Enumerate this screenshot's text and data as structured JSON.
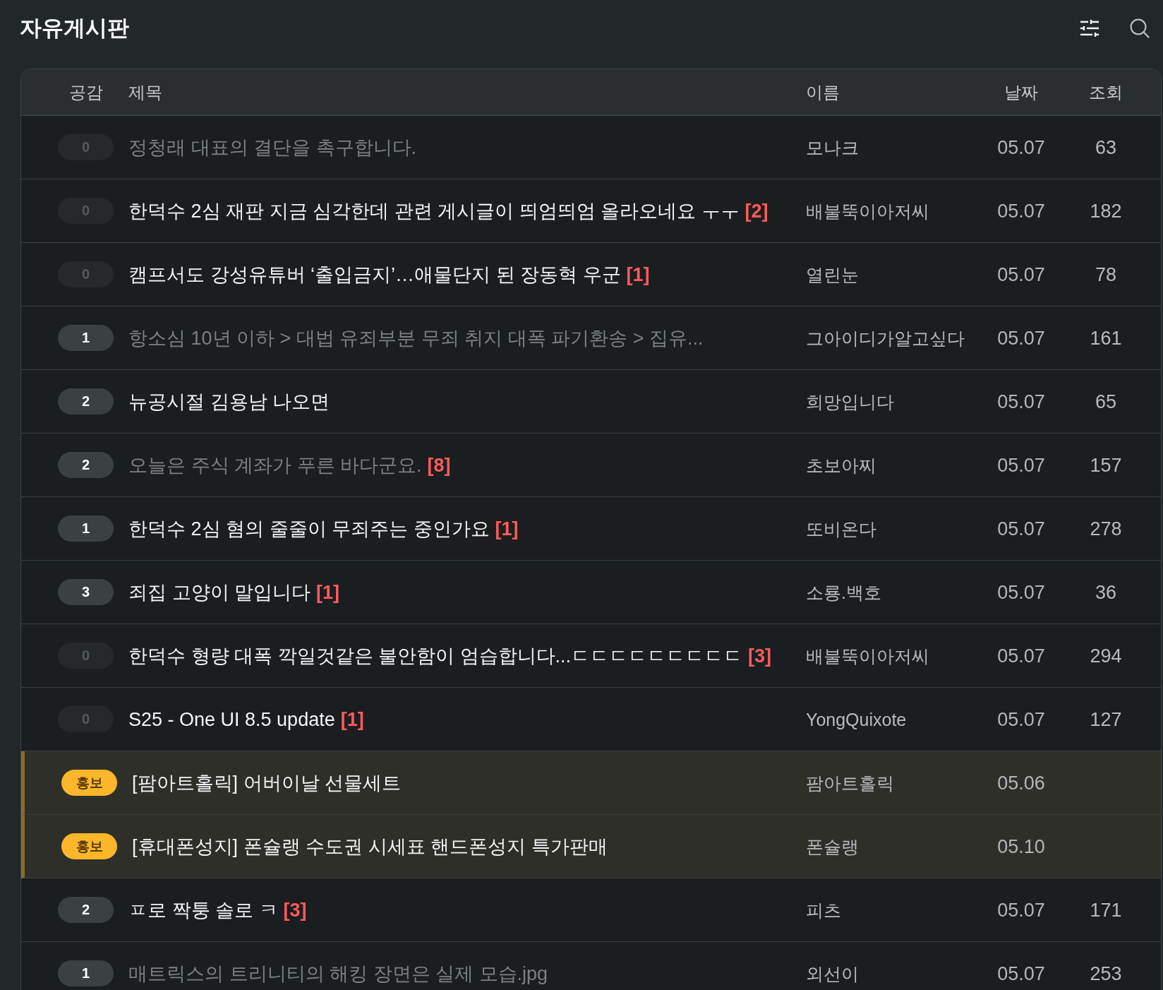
{
  "header": {
    "title": "자유게시판"
  },
  "table": {
    "columns": [
      "공감",
      "제목",
      "이름",
      "날짜",
      "조회"
    ],
    "rows": [
      {
        "kind": "post",
        "likes": "0",
        "likes_dimmed": true,
        "title": {
          "text": "정청래 대표의 결단을 촉구합니다."
        },
        "read": true,
        "author": "모나크",
        "date": "05.07",
        "views": "63"
      },
      {
        "kind": "post",
        "likes": "0",
        "likes_dimmed": true,
        "title": {
          "text": "한덕수 2심 재판 지금 심각한데 관련 게시글이 띄엄띄엄 올라오네요 ㅜㅜ",
          "comments": "[2]"
        },
        "read": false,
        "author": "배불뚝이아저씨",
        "date": "05.07",
        "views": "182"
      },
      {
        "kind": "post",
        "likes": "0",
        "likes_dimmed": true,
        "title": {
          "text": "캠프서도 강성유튜버 ‘출입금지’…애물단지 된 장동혁 우군",
          "comments": "[1]"
        },
        "read": false,
        "author": "열린눈",
        "date": "05.07",
        "views": "78"
      },
      {
        "kind": "post",
        "likes": "1",
        "likes_dimmed": false,
        "title": {
          "text": "항소심 10년 이하 > 대법 유죄부분 무죄 취지 대폭 파기환송 > 집유..."
        },
        "read": true,
        "author": "그아이디가알고싶다",
        "date": "05.07",
        "views": "161"
      },
      {
        "kind": "post",
        "likes": "2",
        "likes_dimmed": false,
        "title": {
          "text": "뉴공시절 김용남 나오면"
        },
        "read": false,
        "author": "희망입니다",
        "date": "05.07",
        "views": "65"
      },
      {
        "kind": "post",
        "likes": "2",
        "likes_dimmed": false,
        "title": {
          "text": "오늘은 주식 계좌가 푸른 바다군요.",
          "comments": "[8]"
        },
        "read": true,
        "author": "초보아찌",
        "date": "05.07",
        "views": "157"
      },
      {
        "kind": "post",
        "likes": "1",
        "likes_dimmed": false,
        "title": {
          "text": "한덕수 2심 혐의 줄줄이 무죄주는 중인가요",
          "comments": "[1]"
        },
        "read": false,
        "author": "또비온다",
        "date": "05.07",
        "views": "278"
      },
      {
        "kind": "post",
        "likes": "3",
        "likes_dimmed": false,
        "title": {
          "text": "죄집 고양이 말입니다",
          "comments": "[1]"
        },
        "read": false,
        "author": "소룡.백호",
        "date": "05.07",
        "views": "36"
      },
      {
        "kind": "post",
        "likes": "0",
        "likes_dimmed": true,
        "title": {
          "text": "한덕수 형량 대폭 깍일것같은 불안함이 엄습합니다...ㄷㄷㄷㄷㄷㄷㄷㄷㄷ",
          "comments": "[3]"
        },
        "read": false,
        "author": "배불뚝이아저씨",
        "date": "05.07",
        "views": "294"
      },
      {
        "kind": "post",
        "likes": "0",
        "likes_dimmed": true,
        "title": {
          "text": "S25 - One UI 8.5 update",
          "comments": "[1]"
        },
        "read": false,
        "author": "YongQuixote",
        "date": "05.07",
        "views": "127"
      },
      {
        "kind": "ad",
        "badge": "홍보",
        "title": {
          "text": "[팜아트홀릭] 어버이날 선물세트"
        },
        "author": "팜아트홀릭",
        "date": "05.06"
      },
      {
        "kind": "ad",
        "badge": "홍보",
        "title": {
          "text": "[휴대폰성지] 폰슐랭 수도권 시세표 핸드폰성지 특가판매"
        },
        "author": "폰슐랭",
        "date": "05.10"
      },
      {
        "kind": "post",
        "likes": "2",
        "likes_dimmed": false,
        "title": {
          "text": "ㅍ로 짝퉁 솔로 ㅋ",
          "comments": "[3]"
        },
        "read": false,
        "author": "피츠",
        "date": "05.07",
        "views": "171"
      },
      {
        "kind": "post",
        "likes": "1",
        "likes_dimmed": false,
        "title": {
          "text": "매트릭스의 트리니티의 해킹 장면은 실제 모습.jpg"
        },
        "read": true,
        "author": "외선이",
        "date": "05.07",
        "views": "253"
      }
    ]
  }
}
